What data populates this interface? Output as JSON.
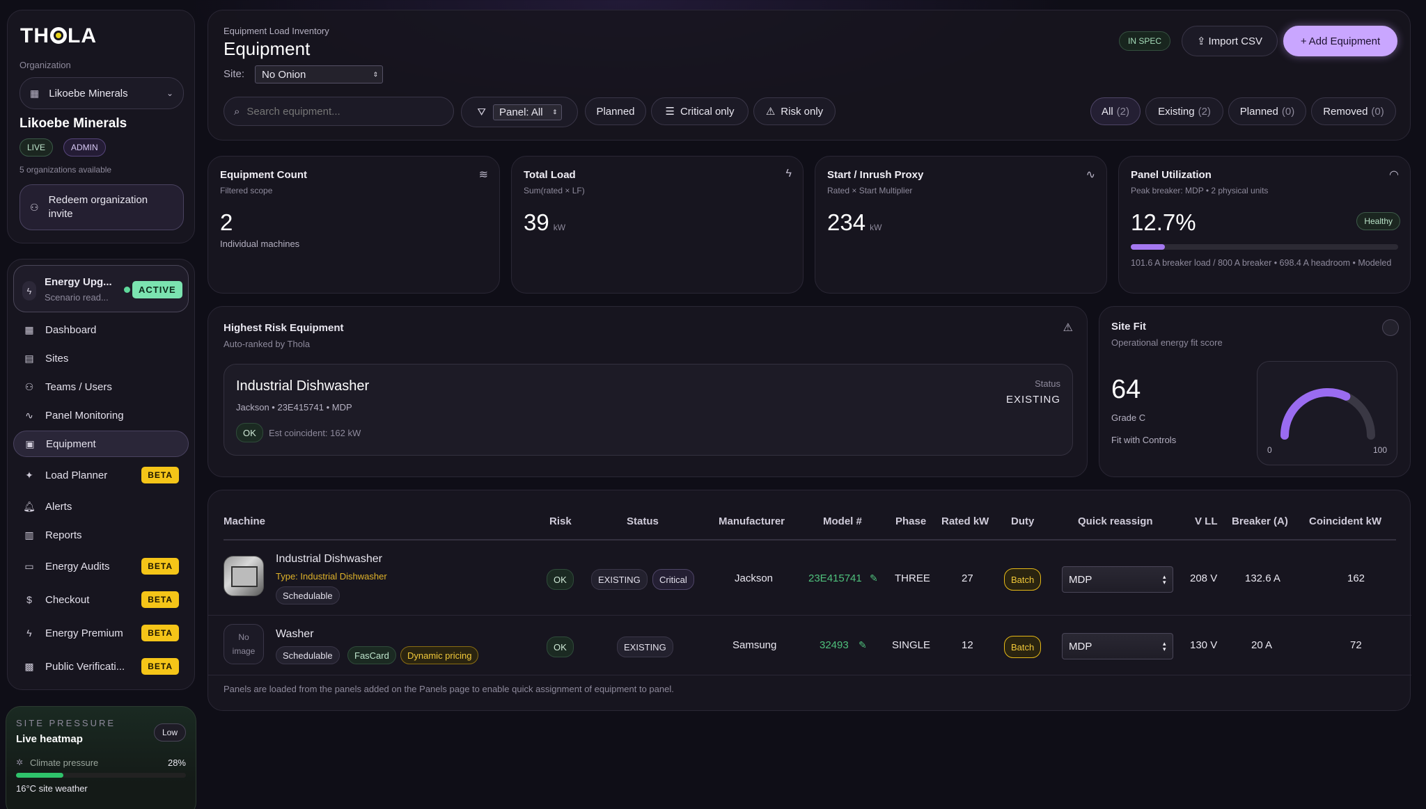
{
  "org": {
    "logo": "THOLA",
    "org_label": "Organization",
    "selected_org": "Likoebe Minerals",
    "org_name": "Likoebe Minerals",
    "badge_live": "LIVE",
    "badge_admin": "ADMIN",
    "available": "5 organizations available",
    "redeem_label": "Redeem organization invite"
  },
  "scenario": {
    "name": "Energy Upg...",
    "sub": "Scenario read...",
    "status": "ACTIVE"
  },
  "nav": [
    {
      "label": "Dashboard",
      "icon": "dashboard-icon",
      "beta": ""
    },
    {
      "label": "Sites",
      "icon": "building-icon",
      "beta": ""
    },
    {
      "label": "Teams / Users",
      "icon": "users-icon",
      "beta": ""
    },
    {
      "label": "Panel Monitoring",
      "icon": "activity-icon",
      "beta": ""
    },
    {
      "label": "Equipment",
      "icon": "chip-icon",
      "beta": ""
    },
    {
      "label": "Load Planner",
      "icon": "sparkle-icon",
      "beta": "BETA"
    },
    {
      "label": "Alerts",
      "icon": "bell-icon",
      "beta": ""
    },
    {
      "label": "Reports",
      "icon": "chart-icon",
      "beta": ""
    },
    {
      "label": "Energy Audits",
      "icon": "clipboard-icon",
      "beta": "BETA"
    },
    {
      "label": "Checkout",
      "icon": "dollar-icon",
      "beta": "BETA"
    },
    {
      "label": "Energy Premium",
      "icon": "bolt-icon",
      "beta": "BETA"
    },
    {
      "label": "Public Verificati...",
      "icon": "qr-icon",
      "beta": "BETA"
    }
  ],
  "pressure": {
    "label": "SITE PRESSURE",
    "title": "Live heatmap",
    "level": "Low",
    "climate_label": "Climate pressure",
    "climate_pct": "28%",
    "climate_value": 0.28,
    "weather": "16°C site weather"
  },
  "header": {
    "crumb": "Equipment Load Inventory",
    "title": "Equipment",
    "site_label": "Site:",
    "site_value": "No Onion",
    "in_spec": "IN SPEC",
    "import_label": "Import CSV",
    "add_label": "Add Equipment",
    "search_placeholder": "Search equipment...",
    "panel_filter": "Panel: All",
    "planned_filter": "Planned",
    "critical_filter": "Critical only",
    "risk_filter": "Risk only",
    "tabs": [
      {
        "label": "All",
        "count": "(2)"
      },
      {
        "label": "Existing",
        "count": "(2)"
      },
      {
        "label": "Planned",
        "count": "(0)"
      },
      {
        "label": "Removed",
        "count": "(0)"
      }
    ]
  },
  "kpis": {
    "count": {
      "title": "Equipment Count",
      "sub": "Filtered scope",
      "value": "2",
      "foot": "Individual machines"
    },
    "load": {
      "title": "Total Load",
      "sub": "Sum(rated × LF)",
      "value": "39",
      "unit": "kW"
    },
    "inrush": {
      "title": "Start / Inrush Proxy",
      "sub": "Rated × Start Multiplier",
      "value": "234",
      "unit": "kW"
    },
    "panel": {
      "title": "Panel Utilization",
      "sub": "Peak breaker: MDP • 2 physical units",
      "value": "12.7%",
      "badge": "Healthy",
      "fill": 0.127,
      "foot": "101.6 A breaker load / 800 A breaker • 698.4 A headroom • Modeled"
    }
  },
  "risk": {
    "title": "Highest Risk Equipment",
    "sub": "Auto-ranked by Thola",
    "item_name": "Industrial Dishwasher",
    "item_meta": "Jackson • 23E415741 • MDP",
    "status_label": "Status",
    "status_value": "EXISTING",
    "ok": "OK",
    "coincident": "Est coincident: 162 kW"
  },
  "fit": {
    "title": "Site Fit",
    "sub": "Operational energy fit score",
    "score": "64",
    "score_value": 64,
    "grade": "Grade C",
    "note": "Fit with Controls",
    "min": "0",
    "max": "100"
  },
  "table": {
    "headers": [
      "Machine",
      "Risk",
      "Status",
      "Manufacturer",
      "Model #",
      "Phase",
      "Rated kW",
      "Duty",
      "Quick reassign",
      "V LL",
      "Breaker (A)",
      "Coincident kW"
    ],
    "rows": [
      {
        "name": "Industrial Dishwasher",
        "type": "Type: Industrial Dishwasher",
        "tags": [
          "Schedulable"
        ],
        "risk": "OK",
        "status": "EXISTING",
        "status2": "Critical",
        "manufacturer": "Jackson",
        "model": "23E415741",
        "phase": "THREE",
        "rated": "27",
        "duty": "Batch",
        "panel": "MDP",
        "vll": "208 V",
        "breaker": "132.6 A",
        "coincident": "162"
      },
      {
        "name": "Washer",
        "no_image": "No image",
        "tags": [
          "Schedulable",
          "FasCard",
          "Dynamic pricing"
        ],
        "risk": "OK",
        "status": "EXISTING",
        "manufacturer": "Samsung",
        "model": "32493",
        "phase": "SINGLE",
        "rated": "12",
        "duty": "Batch",
        "panel": "MDP",
        "vll": "130 V",
        "breaker": "20 A",
        "coincident": "72"
      }
    ],
    "footnote": "Panels are loaded from the panels added on the Panels page to enable quick assignment of equipment to panel."
  },
  "colors": {
    "accent": "#c9a6ff",
    "beta": "#f5c518",
    "active": "#7be3b0",
    "link": "#4fc07c"
  }
}
